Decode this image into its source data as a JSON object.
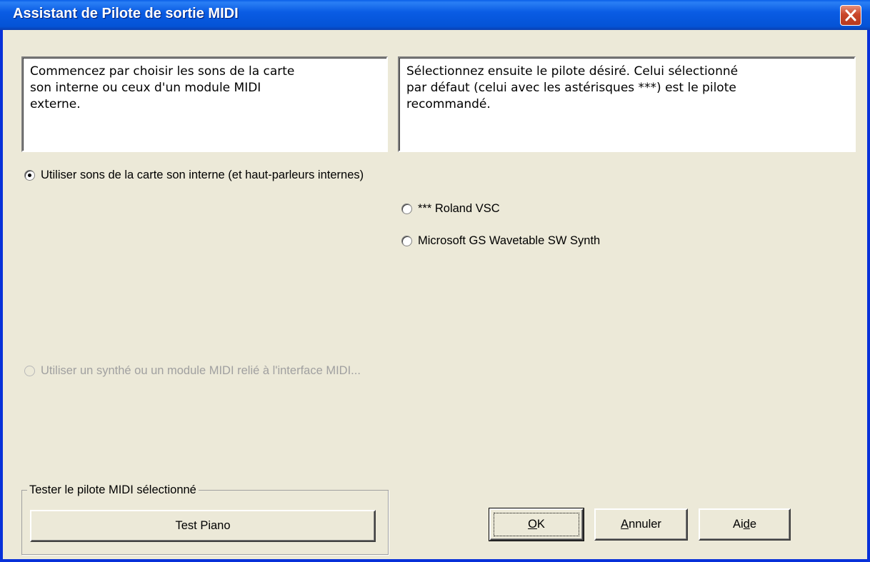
{
  "window": {
    "title": "Assistant de Pilote de sortie MIDI"
  },
  "instructions": {
    "left": "Commencez par choisir les sons de la carte\nson interne ou ceux d'un module MIDI\nexterne.",
    "right": "Sélectionnez ensuite le pilote désiré. Celui sélectionné\npar défaut (celui avec les astérisques ***) est le pilote\nrecommandé."
  },
  "source_options": [
    {
      "label": "Utiliser sons de la carte son interne (et haut-parleurs internes)",
      "selected": true,
      "enabled": true
    },
    {
      "label": "Utiliser un synthé ou un module MIDI relié à l'interface MIDI...",
      "selected": false,
      "enabled": false
    }
  ],
  "driver_options": [
    {
      "label": "*** Roland VSC",
      "selected": false
    },
    {
      "label": "Microsoft GS Wavetable SW Synth",
      "selected": false
    }
  ],
  "test_group": {
    "label": "Tester le pilote MIDI sélectionné",
    "button": "Test Piano"
  },
  "buttons": {
    "ok": {
      "mnemonic": "O",
      "rest": "K"
    },
    "cancel": {
      "mnemonic": "A",
      "rest": "nnuler"
    },
    "help": {
      "pre": "Ai",
      "mnemonic": "d",
      "rest": "e"
    }
  },
  "icons": {
    "close": "close-x-icon"
  },
  "colors": {
    "titlebar": "#0a5ce4",
    "close_button": "#c9462a",
    "dialog_bg": "#ece9d8",
    "disabled_text": "#a0a0a0"
  }
}
